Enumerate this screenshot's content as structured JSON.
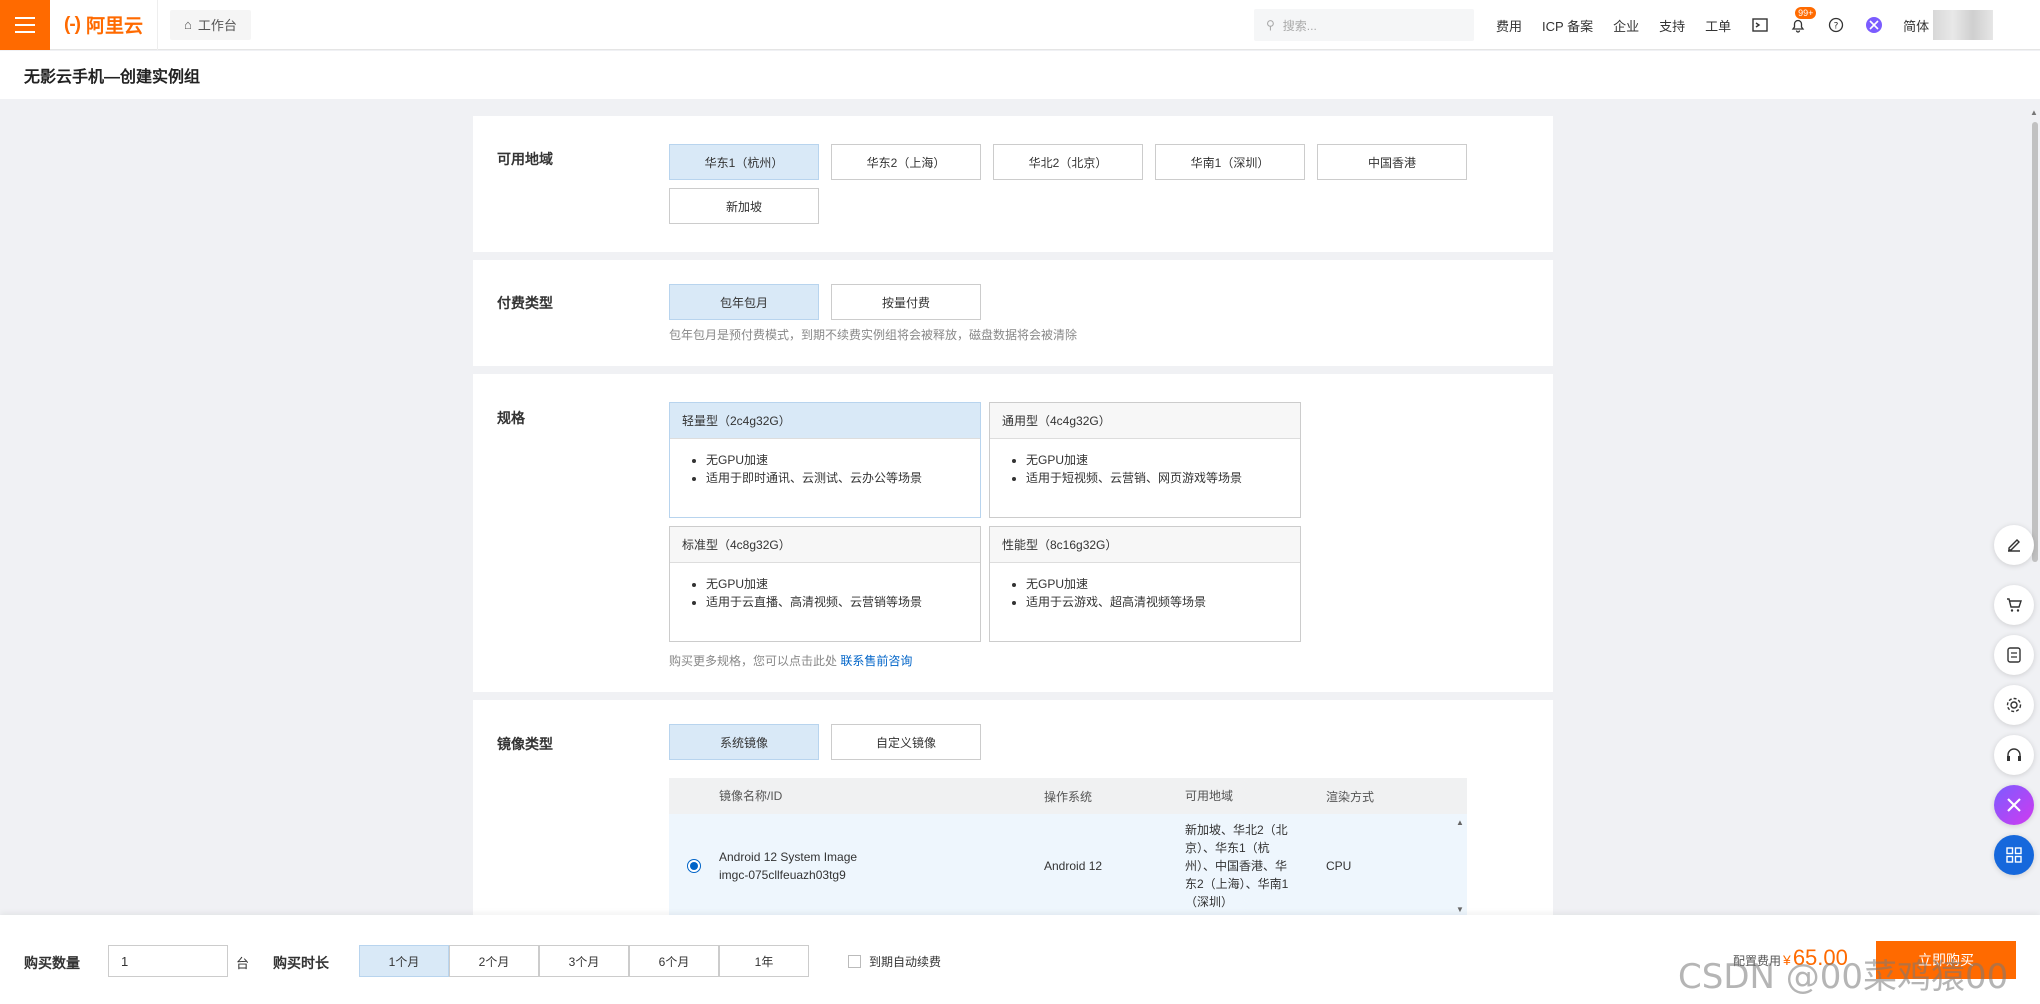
{
  "topbar": {
    "brand": "阿里云",
    "brand_mark": "(-)",
    "workbench": "工作台",
    "search_placeholder": "搜索...",
    "links": [
      "费用",
      "ICP 备案",
      "企业",
      "支持",
      "工单"
    ],
    "notification_badge": "99+",
    "lang": "简体"
  },
  "page": {
    "title": "无影云手机—创建实例组"
  },
  "region": {
    "label": "可用地域",
    "options": [
      "华东1（杭州）",
      "华东2（上海）",
      "华北2（北京）",
      "华南1（深圳）",
      "中国香港",
      "新加坡"
    ],
    "selected": "华东1（杭州）"
  },
  "billing": {
    "label": "付费类型",
    "options": [
      "包年包月",
      "按量付费"
    ],
    "selected": "包年包月",
    "hint": "包年包月是预付费模式，到期不续费实例组将会被释放，磁盘数据将会被清除"
  },
  "spec": {
    "label": "规格",
    "cards": [
      {
        "title": "轻量型（2c4g32G）",
        "items": [
          "无GPU加速",
          "适用于即时通讯、云测试、云办公等场景"
        ]
      },
      {
        "title": "通用型（4c4g32G）",
        "items": [
          "无GPU加速",
          "适用于短视频、云营销、网页游戏等场景"
        ]
      },
      {
        "title": "标准型（4c8g32G）",
        "items": [
          "无GPU加速",
          "适用于云直播、高清视频、云营销等场景"
        ]
      },
      {
        "title": "性能型（8c16g32G）",
        "items": [
          "无GPU加速",
          "适用于云游戏、超高清视频等场景"
        ]
      }
    ],
    "selected": "轻量型（2c4g32G）",
    "hint": "购买更多规格，您可以点击此处",
    "hint_link": "联系售前咨询"
  },
  "image": {
    "label": "镜像类型",
    "options": [
      "系统镜像",
      "自定义镜像"
    ],
    "selected": "系统镜像",
    "columns": [
      "镜像名称/ID",
      "操作系统",
      "可用地域",
      "渲染方式"
    ],
    "rows": [
      {
        "name": "Android 12 System Image",
        "id": "imgc-075cllfeuazh03tg9",
        "os": "Android 12",
        "region_lines": [
          "新加坡、华北2（北",
          "京）、华东1（杭",
          "州）、中国香港、华",
          "东2（上海）、华南1",
          "（深圳）"
        ],
        "render": "CPU"
      }
    ]
  },
  "bottom": {
    "qty_label": "购买数量",
    "qty_value": "1",
    "qty_unit": "台",
    "duration_label": "购买时长",
    "durations": [
      "1个月",
      "2个月",
      "3个月",
      "6个月",
      "1年"
    ],
    "selected_duration": "1个月",
    "auto_renew": "到期自动续费",
    "price_label": "配置费用",
    "price_symbol": "¥",
    "price": "65.00",
    "buy": "立即购买",
    "watermark": "CSDN @00菜鸡猿00"
  },
  "colors": {
    "accent": "#ff6a00",
    "selected_bg": "#d9e9f7",
    "link": "#0064c8"
  }
}
